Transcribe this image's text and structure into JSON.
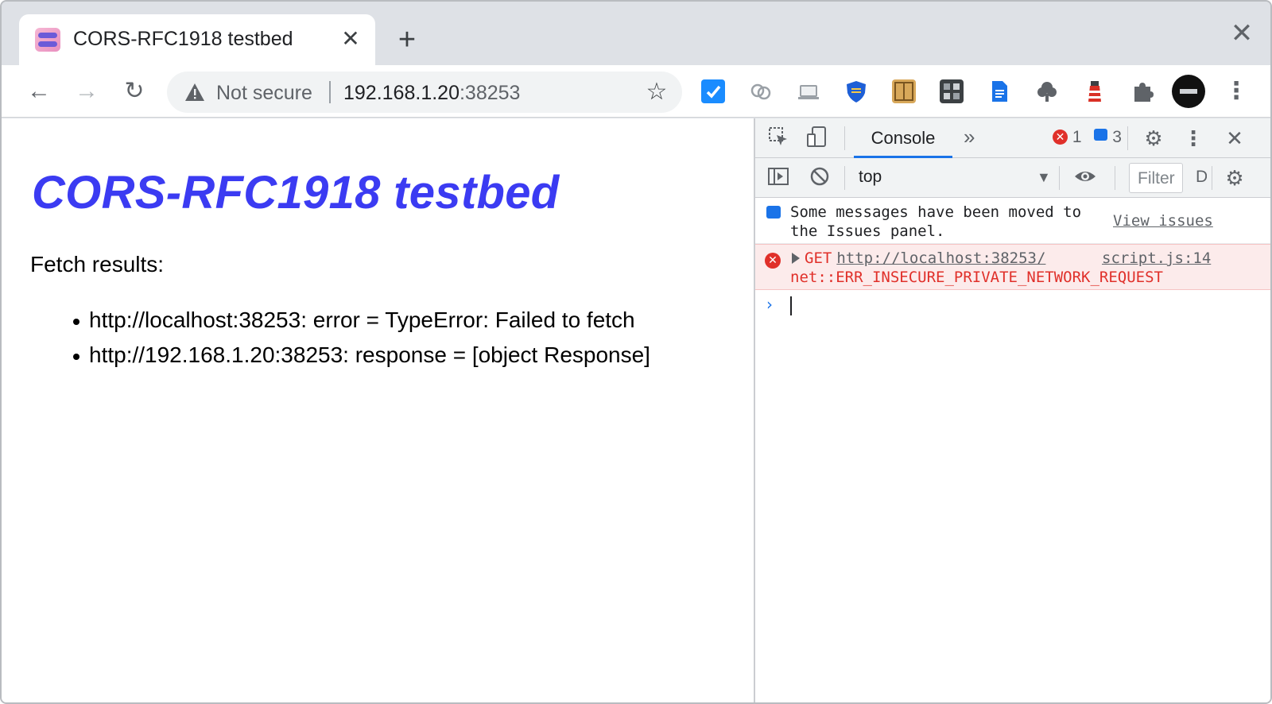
{
  "browser": {
    "tab": {
      "title": "CORS-RFC1918 testbed",
      "close_glyph": "✕"
    },
    "new_tab_glyph": "+",
    "window_close_glyph": "✕",
    "nav": {
      "back_glyph": "←",
      "forward_glyph": "→",
      "reload_glyph": "↻"
    },
    "omnibox": {
      "security_label": "Not secure",
      "url_host": "192.168.1.20",
      "url_port": ":38253",
      "bookmark_glyph": "☆"
    },
    "extensions": [
      {
        "icon": "todo-check-icon",
        "color": "#1a8cff"
      },
      {
        "icon": "circles-icon",
        "color": "#9aa0a6"
      },
      {
        "icon": "laptop-icon",
        "color": "#9aa0a6"
      },
      {
        "icon": "shield-icon",
        "color": "#1e5fd6"
      },
      {
        "icon": "folder-icon",
        "color": "#d8a85a"
      },
      {
        "icon": "grid-image-icon",
        "color": "#3c4043"
      },
      {
        "icon": "document-icon",
        "color": "#1a73e8"
      },
      {
        "icon": "tree-icon",
        "color": "#5f6368"
      },
      {
        "icon": "lighthouse-icon",
        "color": "#d93025"
      },
      {
        "icon": "puzzle-icon",
        "color": "#5f6368"
      },
      {
        "icon": "profile-avatar-icon",
        "color": "#111111"
      }
    ],
    "menu_glyph": "⋮"
  },
  "page": {
    "heading": "CORS-RFC1918 testbed",
    "fetch_label": "Fetch results:",
    "results": [
      "http://localhost:38253: error = TypeError: Failed to fetch",
      "http://192.168.1.20:38253: response = [object Response]"
    ]
  },
  "devtools": {
    "active_tab": "Console",
    "more_tabs_glyph": "»",
    "error_count": "1",
    "message_count": "3",
    "context": "top",
    "filter_placeholder": "Filter",
    "default_levels": "D",
    "messages": {
      "info_text": "Some messages have been moved to the Issues panel.",
      "view_issues": "View issues",
      "error_method": "GET",
      "error_url": "http://localhost:38253/",
      "error_source": "script.js:14",
      "error_detail": "net::ERR_INSECURE_PRIVATE_NETWORK_REQUEST"
    },
    "prompt_glyph": "›"
  }
}
